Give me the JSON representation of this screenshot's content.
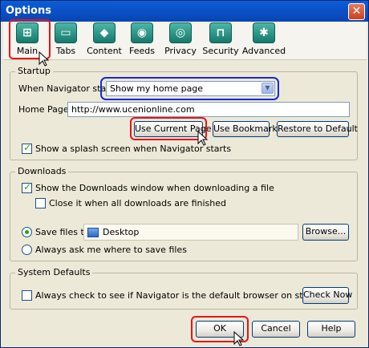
{
  "window": {
    "title": "Options",
    "close_label": "✕"
  },
  "tabs": [
    {
      "label": "Main",
      "icon": "main-grid-icon",
      "glyph": "⊞"
    },
    {
      "label": "Tabs",
      "icon": "tabs-icon",
      "glyph": "▭"
    },
    {
      "label": "Content",
      "icon": "content-icon",
      "glyph": "◆"
    },
    {
      "label": "Feeds",
      "icon": "feeds-icon",
      "glyph": "◉"
    },
    {
      "label": "Privacy",
      "icon": "privacy-icon",
      "glyph": "◎"
    },
    {
      "label": "Security",
      "icon": "security-icon",
      "glyph": "⊓"
    },
    {
      "label": "Advanced",
      "icon": "advanced-icon",
      "glyph": "✱"
    }
  ],
  "startup": {
    "title": "Startup",
    "when_starts_label": "When Navigator starts:",
    "when_starts_value": "Show my home page",
    "home_page_label": "Home Page:",
    "home_page_value": "http://www.ucenionline.com",
    "use_current_page": "Use Current Page",
    "use_bookmark": "Use Bookmark",
    "restore_default": "Restore to Default",
    "splash_label": "Show a splash screen when Navigator starts",
    "splash_checked": true
  },
  "downloads": {
    "title": "Downloads",
    "show_window_label": "Show the Downloads window when downloading a file",
    "show_window_checked": true,
    "close_when_done_label": "Close it when all downloads are finished",
    "close_when_done_checked": false,
    "save_files_label": "Save files to",
    "save_files_value": "Desktop",
    "browse_label": "Browse...",
    "always_ask_label": "Always ask me where to save files"
  },
  "system_defaults": {
    "title": "System Defaults",
    "check_default_label": "Always check to see if Navigator is the default browser on startup",
    "check_default_checked": false,
    "check_now_label": "Check Now"
  },
  "footer": {
    "ok": "OK",
    "cancel": "Cancel",
    "help": "Help"
  },
  "colors": {
    "highlight_red": "#e8131a",
    "highlight_blue": "#1629d9",
    "title_bar": "#0b52c9"
  }
}
